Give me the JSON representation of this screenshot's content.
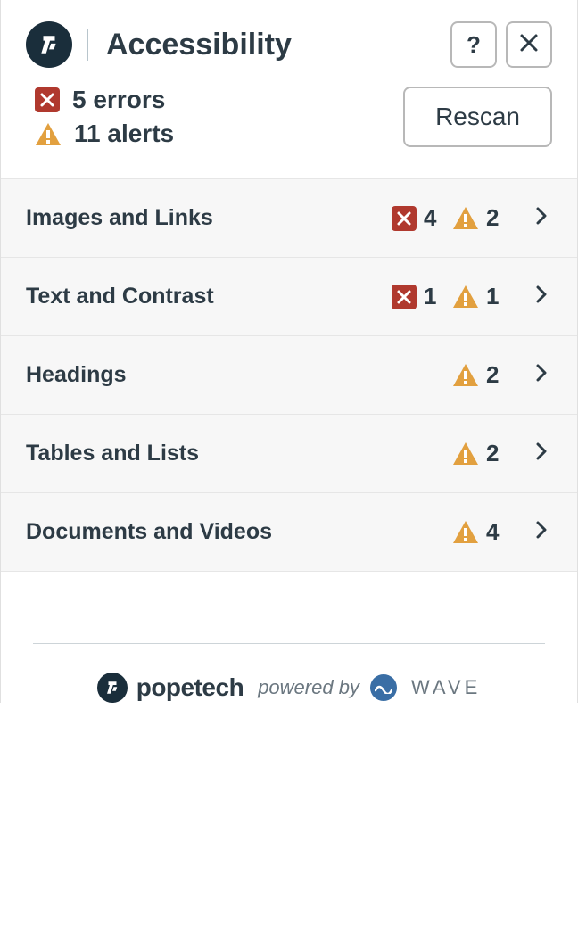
{
  "header": {
    "title": "Accessibility"
  },
  "summary": {
    "errors_label": "5 errors",
    "alerts_label": "11 alerts",
    "rescan_label": "Rescan"
  },
  "categories": [
    {
      "label": "Images and Links",
      "errors": "4",
      "alerts": "2"
    },
    {
      "label": "Text and Contrast",
      "errors": "1",
      "alerts": "1"
    },
    {
      "label": "Headings",
      "errors": null,
      "alerts": "2"
    },
    {
      "label": "Tables and Lists",
      "errors": null,
      "alerts": "2"
    },
    {
      "label": "Documents and Videos",
      "errors": null,
      "alerts": "4"
    }
  ],
  "footer": {
    "brand": "popetech",
    "powered_by": "powered by",
    "wave": "WAVE"
  },
  "colors": {
    "error": "#b0392e",
    "alert": "#e2a03f",
    "text": "#2d3b45"
  }
}
